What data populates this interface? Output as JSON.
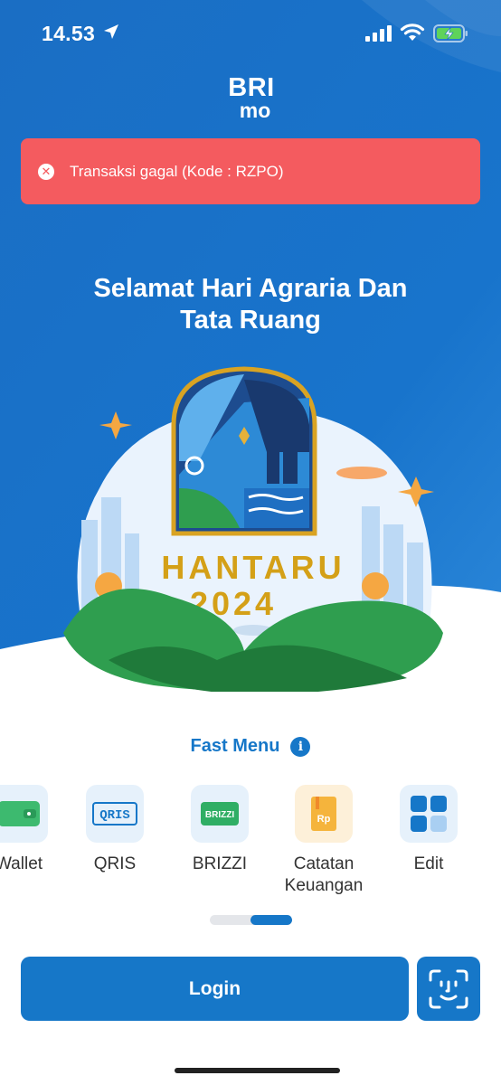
{
  "status_bar": {
    "time": "14.53",
    "icons": [
      "location-arrow-icon",
      "signal-icon",
      "wifi-icon",
      "battery-charging-icon"
    ]
  },
  "logo": {
    "top": "BRI",
    "bottom": "mo"
  },
  "error": {
    "message": "Transaksi gagal (Kode : RZPO)",
    "icon": "close-circle-icon"
  },
  "greeting": {
    "line1": "Selamat Hari Agraria Dan",
    "line2": "Tata Ruang"
  },
  "illustration": {
    "title_line1": "HANTARU",
    "title_line2": "2024"
  },
  "fast_menu": {
    "title": "Fast Menu",
    "items": [
      {
        "label": "Wallet",
        "icon": "wallet-icon"
      },
      {
        "label": "QRIS",
        "icon": "qris-icon",
        "icon_text": "QRIS"
      },
      {
        "label": "BRIZZI",
        "icon": "brizzi-card-icon",
        "icon_text": "BRIZZI"
      },
      {
        "label": "Catatan Keuangan",
        "icon": "notebook-icon",
        "icon_text": "Rp"
      },
      {
        "label": "Edit",
        "icon": "grid-icon"
      }
    ]
  },
  "login": {
    "label": "Login"
  },
  "colors": {
    "primary": "#1677c8",
    "error": "#f45b5f",
    "gold": "#d4a017"
  }
}
